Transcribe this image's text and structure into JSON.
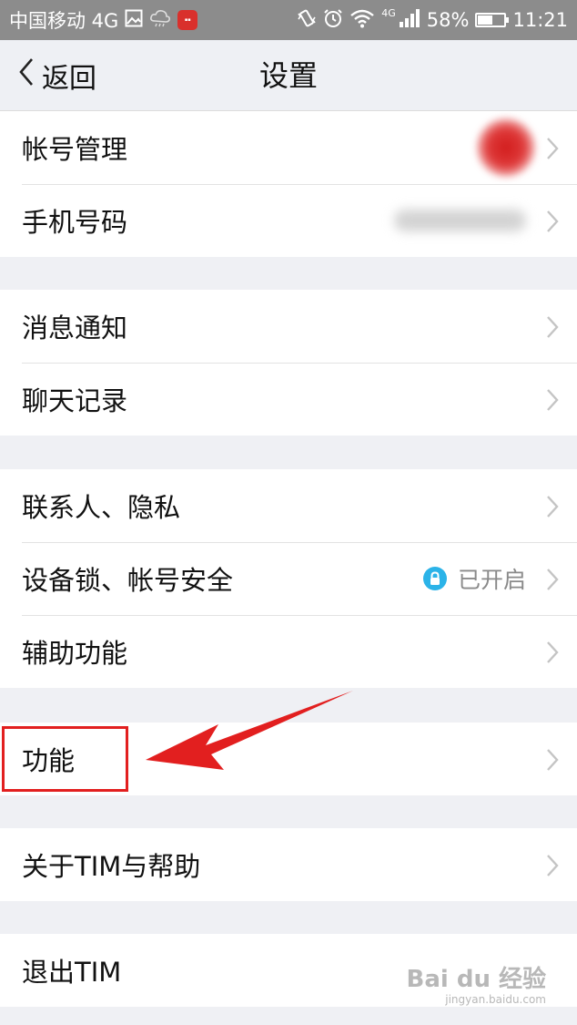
{
  "status_bar": {
    "carrier": "中国移动 4G",
    "network_small": "4G",
    "battery_percent": "58%",
    "battery_level": 0.58,
    "time": "11:21",
    "icons": [
      "image-icon",
      "cloud-icon",
      "app-badge-icon",
      "vibrate-icon",
      "alarm-icon",
      "wifi-icon",
      "signal-icon",
      "battery-icon"
    ]
  },
  "nav": {
    "back_label": "返回",
    "title": "设置"
  },
  "groups": [
    {
      "items": [
        {
          "label": "帐号管理"
        },
        {
          "label": "手机号码"
        }
      ]
    },
    {
      "items": [
        {
          "label": "消息通知"
        },
        {
          "label": "聊天记录"
        }
      ]
    },
    {
      "items": [
        {
          "label": "联系人、隐私"
        },
        {
          "label": "设备锁、帐号安全",
          "status": "已开启"
        },
        {
          "label": "辅助功能"
        }
      ]
    },
    {
      "items": [
        {
          "label": "功能"
        }
      ]
    },
    {
      "items": [
        {
          "label": "关于TIM与帮助"
        }
      ]
    },
    {
      "items": [
        {
          "label": "退出TIM"
        }
      ]
    }
  ],
  "annotation": {
    "highlight_color": "#e21f1f",
    "arrow_color": "#e21f1f"
  },
  "watermark": {
    "main": "Bai du 经验",
    "sub": "jingyan.baidu.com"
  },
  "colors": {
    "page_bg": "#eff0f4",
    "status_bar_bg": "#8c8c8c",
    "lock_badge": "#2bb3e8"
  }
}
